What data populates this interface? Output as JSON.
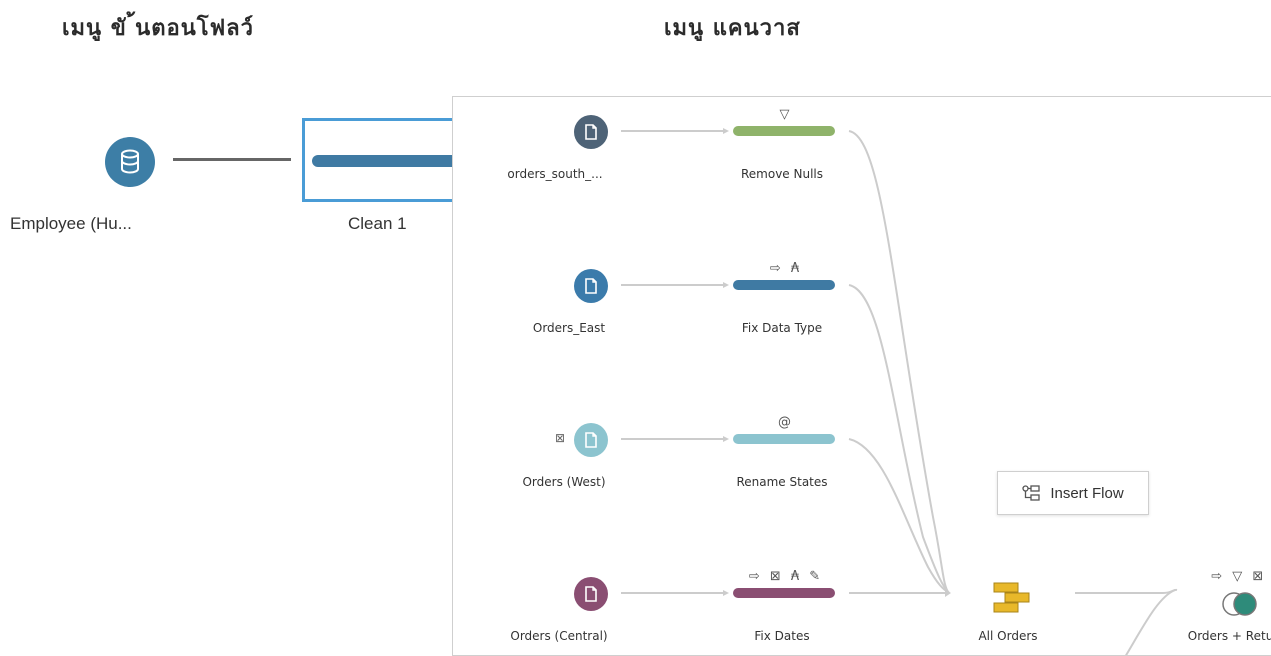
{
  "headings": {
    "left": "เมนู ขั ้นตอนโฟลว์",
    "right": "เมนู แคนวาส"
  },
  "left_panel": {
    "input_label": "Employee (Hu...",
    "step_label": "Clean 1"
  },
  "canvas": {
    "inputs": [
      {
        "label": "orders_south_...",
        "color": "#4e6377"
      },
      {
        "label": "Orders_East",
        "color": "#3b7bab"
      },
      {
        "label": "Orders (West)",
        "color": "#8cc4cf"
      },
      {
        "label": "Orders (Central)",
        "color": "#8a4e72"
      }
    ],
    "steps": [
      {
        "label": "Remove Nulls",
        "color": "#8fb36a",
        "icons": "▽"
      },
      {
        "label": "Fix Data Type",
        "color": "#3f7aa3",
        "icons": "⇨ ₳"
      },
      {
        "label": "Rename States",
        "color": "#8cc4cf",
        "icons": "@"
      },
      {
        "label": "Fix Dates",
        "color": "#8a4e72",
        "icons": "⇨ ⊠ ₳ ✎"
      }
    ],
    "union_label": "All Orders",
    "join_label": "Orders + Retur",
    "join_icons": "⇨ ▽ ⊠ ₳",
    "side_icon": "⊠",
    "insert_flow_label": "Insert Flow",
    "colors": {
      "union": "#e8b82a",
      "join_left": "#ffffff",
      "join_right": "#2e8b7a",
      "line": "#cccccc"
    }
  }
}
